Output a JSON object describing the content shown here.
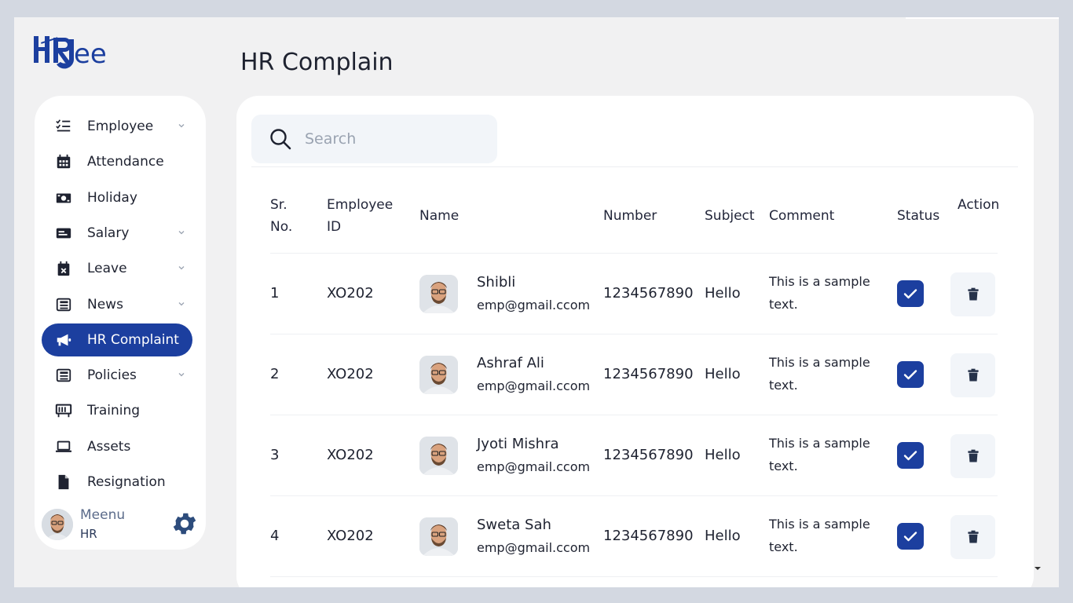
{
  "brand": {
    "logo_text": "HRJee",
    "accent": "#1c3f9f"
  },
  "sidebar": {
    "items": [
      {
        "label": "Employee",
        "icon": "list-check-icon",
        "has_submenu": true
      },
      {
        "label": "Attendance",
        "icon": "calendar-icon",
        "has_submenu": false
      },
      {
        "label": "Holiday",
        "icon": "money-bill-icon",
        "has_submenu": false
      },
      {
        "label": "Salary",
        "icon": "id-card-icon",
        "has_submenu": true
      },
      {
        "label": "Leave",
        "icon": "calendar-x-icon",
        "has_submenu": true
      },
      {
        "label": "News",
        "icon": "newspaper-icon",
        "has_submenu": true
      },
      {
        "label": "HR Complaint",
        "icon": "megaphone-icon",
        "has_submenu": false,
        "active": true
      },
      {
        "label": "Policies",
        "icon": "newspaper-icon",
        "has_submenu": true
      },
      {
        "label": "Training",
        "icon": "chalkboard-icon",
        "has_submenu": false
      },
      {
        "label": "Assets",
        "icon": "laptop-icon",
        "has_submenu": false
      },
      {
        "label": "Resignation",
        "icon": "file-icon",
        "has_submenu": false
      }
    ],
    "profile": {
      "name": "Meenu",
      "role": "HR"
    }
  },
  "page": {
    "title": "HR Complain"
  },
  "search": {
    "placeholder": "Search",
    "value": ""
  },
  "table": {
    "headers": {
      "sr_line1": "Sr.",
      "sr_line2": "No.",
      "emp_line1": "Employee",
      "emp_line2": "ID",
      "name": "Name",
      "number": "Number",
      "subject": "Subject",
      "comment": "Comment",
      "status": "Status",
      "action": "Action"
    },
    "rows": [
      {
        "sr": "1",
        "employee_id": "XO202",
        "name": "Shibli",
        "email": "emp@gmail.ccom",
        "number": "1234567890",
        "subject": "Hello",
        "comment_line1": "This is a sample",
        "comment_line2": "text.",
        "status": true
      },
      {
        "sr": "2",
        "employee_id": "XO202",
        "name": "Ashraf Ali",
        "email": "emp@gmail.ccom",
        "number": "1234567890",
        "subject": "Hello",
        "comment_line1": "This is a sample",
        "comment_line2": "text.",
        "status": true
      },
      {
        "sr": "3",
        "employee_id": "XO202",
        "name": "Jyoti Mishra",
        "email": "emp@gmail.ccom",
        "number": "1234567890",
        "subject": "Hello",
        "comment_line1": "This is a sample",
        "comment_line2": "text.",
        "status": true
      },
      {
        "sr": "4",
        "employee_id": "XO202",
        "name": "Sweta Sah",
        "email": "emp@gmail.ccom",
        "number": "1234567890",
        "subject": "Hello",
        "comment_line1": "This is a sample",
        "comment_line2": "text.",
        "status": true
      }
    ]
  }
}
